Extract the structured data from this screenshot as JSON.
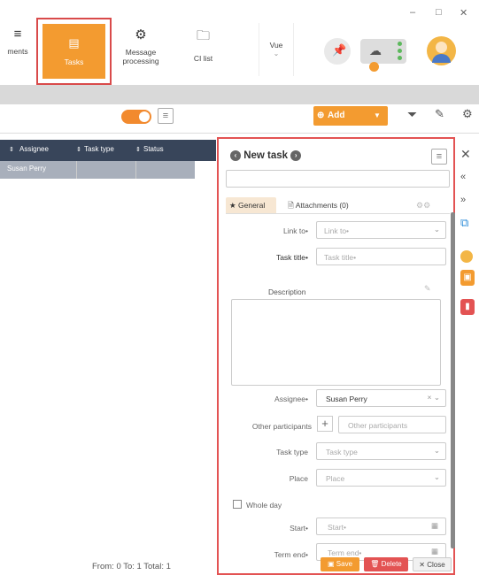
{
  "window_controls": {
    "minimize": "–",
    "maximize": "□",
    "close": "✕"
  },
  "toolbar": {
    "left_icon": "≡",
    "left_label": "ments",
    "tasks_label": "Tasks",
    "message_processing_label": "Message processing",
    "ci_list_label": "CI list",
    "vue_label": "Vue"
  },
  "secondary": {
    "add_label": "Add"
  },
  "table": {
    "headers": [
      "Assignee",
      "Task type",
      "Status"
    ],
    "rows": [
      [
        "Susan Perry",
        "",
        ""
      ]
    ]
  },
  "footer": {
    "text": "From: 0   To: 1   Total: 1"
  },
  "task_panel": {
    "title": "New task",
    "tabs": {
      "general": "General",
      "attachments": "Attachments (0)"
    },
    "link_to_label": "Link to•",
    "link_to_placeholder": "Link to•",
    "task_title_label": "Task title•",
    "task_title_placeholder": "Task title•",
    "description_label": "Description",
    "assignee_label": "Assignee•",
    "assignee_value": "Susan Perry",
    "other_participants_label": "Other participants",
    "other_participants_placeholder": "Other participants",
    "task_type_label": "Task type",
    "task_type_placeholder": "Task type",
    "place_label": "Place",
    "place_placeholder": "Place",
    "whole_day_label": "Whole day",
    "start_label": "Start•",
    "start_placeholder": "Start•",
    "term_end_label": "Term end•",
    "term_end_placeholder": "Term end•",
    "save_label": "Save",
    "delete_label": "Delete",
    "close_label": "Close"
  },
  "colors": {
    "accent": "#f39b30",
    "danger": "#e35353",
    "header": "#38455a"
  }
}
